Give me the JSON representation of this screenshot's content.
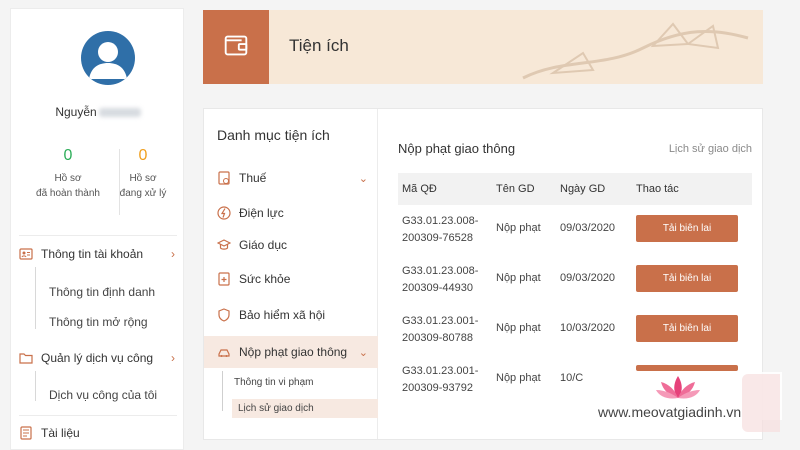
{
  "user": {
    "name": "Nguyễn",
    "stats": [
      {
        "value": "0",
        "label_line1": "Hồ sơ",
        "label_line2": "đã hoàn thành"
      },
      {
        "value": "0",
        "label_line1": "Hồ sơ",
        "label_line2": "đang xử lý"
      }
    ]
  },
  "sidebar": {
    "sections": [
      {
        "label": "Thông tin tài khoản",
        "icon": "account-card-icon",
        "children": [
          "Thông tin định danh",
          "Thông tin mở rộng"
        ]
      },
      {
        "label": "Quản lý dịch vụ công",
        "icon": "folder-icon",
        "children": [
          "Dịch vụ công của tôi"
        ]
      },
      {
        "label": "Tài liệu",
        "icon": "document-icon",
        "children": []
      }
    ]
  },
  "banner": {
    "title": "Tiện ích",
    "icon": "wallet-icon"
  },
  "categories": {
    "title": "Danh mục tiện ích",
    "items": [
      {
        "label": "Thuế",
        "icon": "tax-doc-icon"
      },
      {
        "label": "Điện lực",
        "icon": "electricity-icon"
      },
      {
        "label": "Giáo dục",
        "icon": "graduation-cap-icon"
      },
      {
        "label": "Sức khỏe",
        "icon": "health-doc-icon"
      },
      {
        "label": "Bảo hiểm xã hội",
        "icon": "insurance-icon"
      },
      {
        "label": "Nộp phạt giao thông",
        "icon": "traffic-fine-icon"
      }
    ],
    "subitems": [
      "Thông tin vi phạm",
      "Lịch sử giao dịch"
    ]
  },
  "main": {
    "title": "Nộp phạt giao thông",
    "history_link": "Lịch sử giao dịch",
    "columns": [
      "Mã QĐ",
      "Tên GD",
      "Ngày GD",
      "Thao tác"
    ],
    "rows": [
      {
        "code_line1": "G33.01.23.008-",
        "code_line2": "200309-76528",
        "name": "Nộp phạt",
        "date": "09/03/2020",
        "action": "Tải biên lai"
      },
      {
        "code_line1": "G33.01.23.008-",
        "code_line2": "200309-44930",
        "name": "Nộp phạt",
        "date": "09/03/2020",
        "action": "Tải biên lai"
      },
      {
        "code_line1": "G33.01.23.001-",
        "code_line2": "200309-80788",
        "name": "Nộp phạt",
        "date": "10/03/2020",
        "action": "Tải biên lai"
      },
      {
        "code_line1": "G33.01.23.001-",
        "code_line2": "200309-93792",
        "name": "Nộp phạt",
        "date": "10/C",
        "action": ""
      }
    ]
  },
  "watermark": {
    "text": "www.meovatgiadinh.vn"
  },
  "colors": {
    "accent": "#c9704a",
    "banner_bg": "#f7e8d7",
    "active_bg": "#f7e9e1",
    "done": "#2eae5a",
    "pending": "#f0a020"
  }
}
